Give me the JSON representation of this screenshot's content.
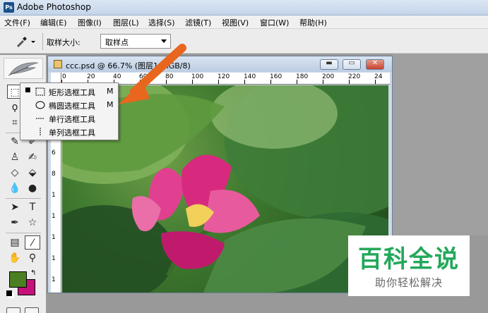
{
  "app": {
    "title": "Adobe Photoshop",
    "icon": "photoshop-icon"
  },
  "menu": [
    {
      "label": "文件(F)"
    },
    {
      "label": "编辑(E)"
    },
    {
      "label": "图像(I)"
    },
    {
      "label": "图层(L)"
    },
    {
      "label": "选择(S)"
    },
    {
      "label": "滤镜(T)"
    },
    {
      "label": "视图(V)"
    },
    {
      "label": "窗口(W)"
    },
    {
      "label": "帮助(H)"
    }
  ],
  "options": {
    "tool_icon": "eyedropper-icon",
    "sample_label": "取样大小:",
    "sample_value": "取样点"
  },
  "document": {
    "title": "ccc.psd @ 66.7% (图层1, RGB/8)",
    "ruler_h": [
      "0",
      "20",
      "40",
      "60",
      "80",
      "100",
      "120",
      "140",
      "160",
      "180",
      "200",
      "220",
      "24"
    ],
    "ruler_v": [
      "1",
      "2",
      "4",
      "6",
      "8",
      "1",
      "1",
      "1",
      "1",
      "1"
    ]
  },
  "flyout": {
    "items": [
      {
        "label": "矩形选框工具",
        "key": "M",
        "icon": "rect-marquee-icon",
        "selected": true
      },
      {
        "label": "椭圆选框工具",
        "key": "M",
        "icon": "ellipse-marquee-icon",
        "selected": false
      },
      {
        "label": "单行选框工具",
        "key": "",
        "icon": "single-row-marquee-icon",
        "selected": false
      },
      {
        "label": "单列选框工具",
        "key": "",
        "icon": "single-column-marquee-icon",
        "selected": false
      }
    ]
  },
  "colors": {
    "foreground": "#4a7f22",
    "background": "#c4127a",
    "annotation_arrow": "#e8661e",
    "watermark": "#22a85a"
  },
  "watermark": {
    "main": "百科全说",
    "sub": "助你轻松解决"
  }
}
